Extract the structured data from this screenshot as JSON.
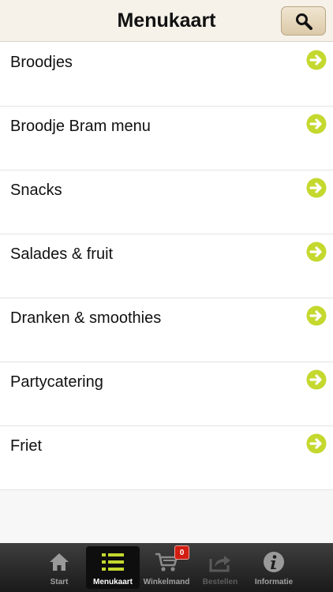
{
  "header": {
    "title": "Menukaart",
    "search_icon": "search-icon"
  },
  "menu": {
    "items": [
      {
        "label": "Broodjes",
        "icon": "arrow-right-circle-icon"
      },
      {
        "label": "Broodje Bram menu",
        "icon": "arrow-right-circle-icon"
      },
      {
        "label": "Snacks",
        "icon": "arrow-right-circle-icon"
      },
      {
        "label": "Salades & fruit",
        "icon": "arrow-right-circle-icon"
      },
      {
        "label": "Dranken & smoothies",
        "icon": "arrow-right-circle-icon"
      },
      {
        "label": "Partycatering",
        "icon": "arrow-right-circle-icon"
      },
      {
        "label": "Friet",
        "icon": "arrow-right-circle-icon"
      }
    ],
    "arrow_color": "#c4d82e"
  },
  "tabbar": {
    "tabs": [
      {
        "label": "Start",
        "icon": "home-icon"
      },
      {
        "label": "Menukaart",
        "icon": "list-icon",
        "active": true
      },
      {
        "label": "Winkelmand",
        "icon": "cart-icon",
        "badge": "0"
      },
      {
        "label": "Bestellen",
        "icon": "share-icon",
        "disabled": true
      },
      {
        "label": "Informatie",
        "icon": "info-icon"
      }
    ],
    "accent_color": "#c4d82e",
    "badge_color": "#d21d12"
  }
}
